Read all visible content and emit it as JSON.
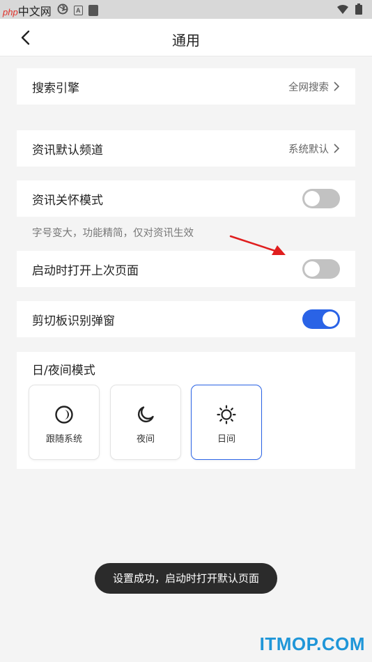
{
  "status_bar": {
    "watermark_prefix": "php",
    "watermark_text": "中文网"
  },
  "header": {
    "title": "通用"
  },
  "settings": {
    "search_engine": {
      "label": "搜索引擎",
      "value": "全网搜索"
    },
    "news_channel": {
      "label": "资讯默认频道",
      "value": "系统默认"
    },
    "care_mode": {
      "label": "资讯关怀模式",
      "enabled": false,
      "hint": "字号变大，功能精简，仅对资讯生效"
    },
    "restore_last_page": {
      "label": "启动时打开上次页面",
      "enabled": false
    },
    "clipboard_popup": {
      "label": "剪切板识别弹窗",
      "enabled": true
    }
  },
  "display_mode": {
    "title": "日/夜间模式",
    "options": [
      {
        "label": "跟随系统",
        "icon": "follow-system-icon",
        "selected": false
      },
      {
        "label": "夜间",
        "icon": "moon-icon",
        "selected": false
      },
      {
        "label": "日间",
        "icon": "sun-icon",
        "selected": true
      }
    ]
  },
  "toast": {
    "text": "设置成功，启动时打开默认页面"
  },
  "watermark": {
    "text": "ITMOP.COM"
  },
  "colors": {
    "accent": "#2a63e6",
    "toggle_off": "#c2c2c2",
    "arrow": "#e01e1e",
    "watermark": "#1f96d8"
  }
}
